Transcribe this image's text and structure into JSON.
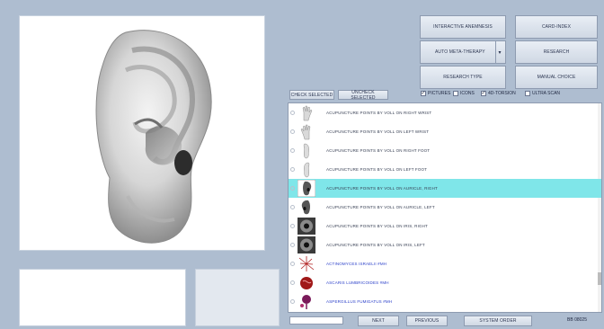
{
  "buttons": {
    "interactive_anamnesis": "INTERACTIVE ANEMNESIS",
    "card_index": "CARD-INDEX",
    "auto_meta_therapy": "AUTO META-THERAPY",
    "research": "RESEARCH",
    "research_type": "RESEARCH TYPE",
    "manual_choice": "MANUAL CHOICE",
    "check_selected": "CHECK SELECTED",
    "uncheck_selected": "UNCHECK SELECTED",
    "next": "NEXT",
    "previous": "PREVIOUS",
    "system_order": "SYSTEM ORDER"
  },
  "dropdown_arrow": "▾",
  "options": [
    {
      "label": "PICTURES",
      "checked": true
    },
    {
      "label": "ICONS",
      "checked": false
    },
    {
      "label": "4D-TORSION",
      "checked": true
    },
    {
      "label": "ULTRA SCAN",
      "checked": false
    }
  ],
  "status_text": "BB 08025",
  "list_items": [
    {
      "label": "ACUPUNCTURE POINTS BY VOLL ON RIGHT WRIST",
      "thumb": "hand-icon",
      "blue": false,
      "selected": false
    },
    {
      "label": "ACUPUNCTURE POINTS BY VOLL ON LEFT WRIST",
      "thumb": "hand-icon",
      "blue": false,
      "selected": false
    },
    {
      "label": "ACUPUNCTURE POINTS BY VOLL ON RIGHT FOOT",
      "thumb": "foot-icon",
      "blue": false,
      "selected": false
    },
    {
      "label": "ACUPUNCTURE POINTS BY VOLL ON LEFT FOOT",
      "thumb": "foot-icon",
      "blue": false,
      "selected": false
    },
    {
      "label": "ACUPUNCTURE POINTS BY VOLL ON AURICLE, RIGHT",
      "thumb": "ear-icon",
      "blue": false,
      "selected": true
    },
    {
      "label": "ACUPUNCTURE POINTS BY VOLL ON AURICLE, LEFT",
      "thumb": "ear-icon",
      "blue": false,
      "selected": false
    },
    {
      "label": "ACUPUNCTURE POINTS BY VOLL ON IRIS, RIGHT",
      "thumb": "iris-icon",
      "blue": false,
      "selected": false
    },
    {
      "label": "ACUPUNCTURE POINTS BY VOLL ON IRIS, LEFT",
      "thumb": "iris-icon",
      "blue": false,
      "selected": false
    },
    {
      "label": "ACTINOMYCES ISRAELII #MH",
      "thumb": "actinomyces-icon",
      "blue": true,
      "selected": false
    },
    {
      "label": "ASCARIS LUMBRICOIDES #MH",
      "thumb": "ascaris-icon",
      "blue": true,
      "selected": false
    },
    {
      "label": "ASPERGILLUS FUMIGATUS #MH",
      "thumb": "aspergillus-icon",
      "blue": true,
      "selected": false
    }
  ],
  "colors": {
    "selected_row": "#7fe6e9",
    "microbe_text": "#2a3fc9",
    "background": "#aebdd0"
  }
}
